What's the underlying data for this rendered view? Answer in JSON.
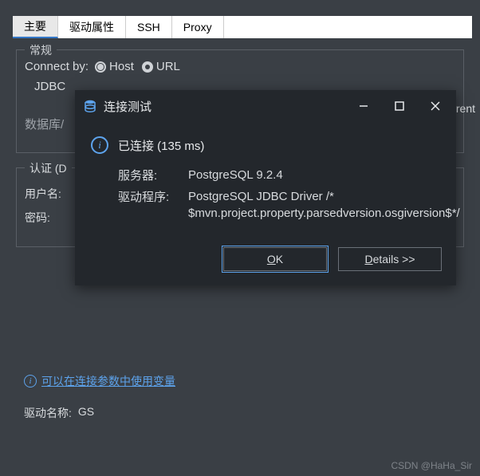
{
  "tabs": {
    "main": "主要",
    "driver_props": "驱动属性",
    "ssh": "SSH",
    "proxy": "Proxy"
  },
  "general": {
    "legend": "常规",
    "connect_by": "Connect by:",
    "host": "Host",
    "url": "URL",
    "jdbc": "JDBC",
    "db_schema": "数据库/"
  },
  "auth": {
    "legend": "认证 (D",
    "username": "用户名:",
    "password": "密码:"
  },
  "clipped": "rrent",
  "variable_link": "可以在连接参数中使用变量",
  "driver": {
    "label": "驱动名称:",
    "value": "GS"
  },
  "watermark": "CSDN @HaHa_Sir",
  "dialog": {
    "title": "连接测试",
    "status": "已连接 (135 ms)",
    "server_label": "服务器:",
    "server_value": "PostgreSQL 9.2.4",
    "driver_label": "驱动程序:",
    "driver_value": "PostgreSQL JDBC Driver /* $mvn.project.property.parsedversion.osgiversion$*/",
    "ok_o": "O",
    "ok_k": "K",
    "details_d": "D",
    "details_rest": "etails >>"
  }
}
